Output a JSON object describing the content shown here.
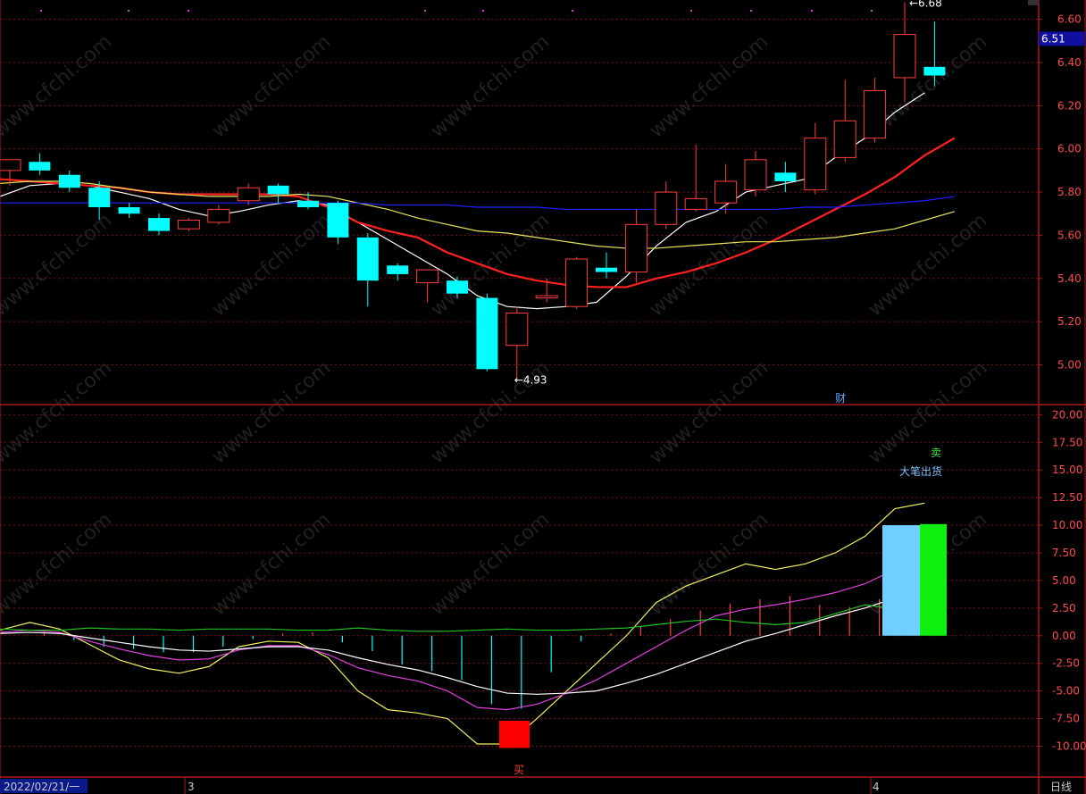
{
  "chart_data": [
    {
      "type": "candlestick",
      "panel": "price",
      "ylim": [
        4.82,
        6.64
      ],
      "yticks": [
        "6.60",
        "6.40",
        "6.20",
        "6.00",
        "5.80",
        "5.60",
        "5.40",
        "5.20",
        "5.00"
      ],
      "last_price_label": "6.51",
      "high_label": "6.68",
      "low_label": "4.93",
      "candles": [
        {
          "o": 5.9,
          "h": 5.95,
          "l": 5.83,
          "c": 5.95
        },
        {
          "o": 5.94,
          "h": 5.98,
          "l": 5.88,
          "c": 5.9
        },
        {
          "o": 5.88,
          "h": 5.9,
          "l": 5.8,
          "c": 5.82
        },
        {
          "o": 5.82,
          "h": 5.85,
          "l": 5.67,
          "c": 5.73
        },
        {
          "o": 5.73,
          "h": 5.75,
          "l": 5.68,
          "c": 5.7
        },
        {
          "o": 5.68,
          "h": 5.7,
          "l": 5.6,
          "c": 5.62
        },
        {
          "o": 5.63,
          "h": 5.68,
          "l": 5.62,
          "c": 5.67
        },
        {
          "o": 5.66,
          "h": 5.74,
          "l": 5.65,
          "c": 5.72
        },
        {
          "o": 5.76,
          "h": 5.84,
          "l": 5.74,
          "c": 5.82
        },
        {
          "o": 5.83,
          "h": 5.84,
          "l": 5.75,
          "c": 5.79
        },
        {
          "o": 5.76,
          "h": 5.8,
          "l": 5.72,
          "c": 5.73
        },
        {
          "o": 5.75,
          "h": 5.76,
          "l": 5.56,
          "c": 5.59
        },
        {
          "o": 5.59,
          "h": 5.61,
          "l": 5.27,
          "c": 5.39
        },
        {
          "o": 5.46,
          "h": 5.47,
          "l": 5.39,
          "c": 5.42
        },
        {
          "o": 5.38,
          "h": 5.44,
          "l": 5.29,
          "c": 5.44
        },
        {
          "o": 5.39,
          "h": 5.41,
          "l": 5.31,
          "c": 5.33
        },
        {
          "o": 5.31,
          "h": 5.33,
          "l": 4.97,
          "c": 4.98
        },
        {
          "o": 5.09,
          "h": 5.27,
          "l": 4.93,
          "c": 5.24
        },
        {
          "o": 5.31,
          "h": 5.4,
          "l": 5.29,
          "c": 5.32
        },
        {
          "o": 5.27,
          "h": 5.5,
          "l": 5.26,
          "c": 5.49
        },
        {
          "o": 5.45,
          "h": 5.52,
          "l": 5.4,
          "c": 5.43
        },
        {
          "o": 5.43,
          "h": 5.72,
          "l": 5.38,
          "c": 5.65
        },
        {
          "o": 5.65,
          "h": 5.85,
          "l": 5.63,
          "c": 5.8
        },
        {
          "o": 5.72,
          "h": 6.02,
          "l": 5.71,
          "c": 5.77
        },
        {
          "o": 5.75,
          "h": 5.93,
          "l": 5.7,
          "c": 5.85
        },
        {
          "o": 5.81,
          "h": 5.99,
          "l": 5.78,
          "c": 5.95
        },
        {
          "o": 5.89,
          "h": 5.94,
          "l": 5.8,
          "c": 5.85
        },
        {
          "o": 5.81,
          "h": 6.12,
          "l": 5.79,
          "c": 6.05
        },
        {
          "o": 5.96,
          "h": 6.32,
          "l": 5.94,
          "c": 6.13
        },
        {
          "o": 6.05,
          "h": 6.33,
          "l": 6.03,
          "c": 6.27
        },
        {
          "o": 6.33,
          "h": 6.68,
          "l": 6.22,
          "c": 6.53
        },
        {
          "o": 6.38,
          "h": 6.59,
          "l": 6.29,
          "c": 6.34
        }
      ],
      "ma_lines": [
        {
          "color": "#ffffff",
          "values": [
            5.78,
            5.83,
            5.84,
            5.83,
            5.8,
            5.77,
            5.72,
            5.69,
            5.71,
            5.74,
            5.76,
            5.74,
            5.66,
            5.58,
            5.5,
            5.42,
            5.32,
            5.27,
            5.26,
            5.27,
            5.29,
            5.41,
            5.55,
            5.66,
            5.71,
            5.8,
            5.83,
            5.86,
            5.96,
            6.05,
            6.17,
            6.26
          ]
        },
        {
          "color": "#ff2020",
          "values": [
            5.86,
            5.85,
            5.84,
            5.83,
            5.82,
            5.8,
            5.79,
            5.79,
            5.79,
            5.79,
            5.78,
            5.73,
            5.66,
            5.62,
            5.59,
            5.52,
            5.47,
            5.42,
            5.39,
            5.37,
            5.36,
            5.36,
            5.4,
            5.43,
            5.47,
            5.52,
            5.58,
            5.65,
            5.72,
            5.79,
            5.87,
            5.97,
            6.05
          ]
        },
        {
          "color": "#e6e65a",
          "values": [
            5.84,
            5.85,
            5.85,
            5.84,
            5.82,
            5.8,
            5.79,
            5.78,
            5.78,
            5.78,
            5.79,
            5.78,
            5.75,
            5.72,
            5.68,
            5.65,
            5.62,
            5.61,
            5.59,
            5.57,
            5.55,
            5.54,
            5.54,
            5.55,
            5.56,
            5.57,
            5.57,
            5.58,
            5.59,
            5.61,
            5.63,
            5.67,
            5.71
          ]
        },
        {
          "color": "#2020ff",
          "values": [
            5.75,
            5.75,
            5.75,
            5.75,
            5.75,
            5.75,
            5.75,
            5.75,
            5.75,
            5.75,
            5.75,
            5.75,
            5.75,
            5.74,
            5.74,
            5.74,
            5.73,
            5.73,
            5.73,
            5.72,
            5.72,
            5.72,
            5.72,
            5.72,
            5.72,
            5.72,
            5.72,
            5.73,
            5.73,
            5.74,
            5.75,
            5.76,
            5.78
          ]
        }
      ],
      "markers": [
        "财"
      ]
    },
    {
      "type": "line",
      "panel": "indicator",
      "ylim": [
        -11.5,
        21.0
      ],
      "yticks": [
        "20.00",
        "17.50",
        "15.00",
        "12.50",
        "10.00",
        "7.50",
        "5.00",
        "2.50",
        "0.00",
        "-2.50",
        "-5.00",
        "-7.50",
        "-10.00"
      ],
      "series": [
        {
          "color": "#f0f060",
          "values": [
            0.5,
            1.2,
            0.6,
            -0.8,
            -2.2,
            -3.0,
            -3.4,
            -2.8,
            -1.0,
            -0.5,
            -0.6,
            -2.0,
            -5.0,
            -6.7,
            -7.0,
            -7.5,
            -9.8,
            -9.8,
            -7.5,
            -5.0,
            -2.5,
            0.0,
            3.0,
            4.5,
            5.5,
            6.5,
            6.0,
            6.5,
            7.5,
            9.0,
            11.5,
            12.0
          ]
        },
        {
          "color": "#e040e0",
          "values": [
            0.3,
            0.5,
            0.3,
            -0.5,
            -1.2,
            -1.8,
            -2.2,
            -2.1,
            -1.3,
            -0.9,
            -0.9,
            -1.7,
            -2.9,
            -3.6,
            -4.1,
            -5.0,
            -6.5,
            -6.7,
            -6.2,
            -5.2,
            -4.0,
            -2.5,
            -1.0,
            0.5,
            1.8,
            2.4,
            2.8,
            3.3,
            3.9,
            4.7,
            6.0,
            7.0
          ]
        },
        {
          "color": "#ffffff",
          "values": [
            0.2,
            0.3,
            0.2,
            -0.2,
            -0.6,
            -1.0,
            -1.3,
            -1.4,
            -1.2,
            -1.0,
            -1.0,
            -1.3,
            -2.0,
            -2.6,
            -3.1,
            -3.8,
            -4.6,
            -5.2,
            -5.3,
            -5.2,
            -5.0,
            -4.3,
            -3.5,
            -2.5,
            -1.5,
            -0.5,
            0.2,
            1.0,
            1.8,
            2.5,
            3.4,
            4.2
          ]
        },
        {
          "color": "#20c020",
          "values": [
            0.6,
            0.5,
            0.5,
            0.7,
            0.6,
            0.6,
            0.5,
            0.6,
            0.6,
            0.6,
            0.5,
            0.5,
            0.7,
            0.5,
            0.4,
            0.4,
            0.5,
            0.6,
            0.5,
            0.5,
            0.6,
            0.7,
            1.0,
            1.3,
            1.5,
            1.2,
            1.0,
            1.2,
            2.0,
            2.8,
            2.4,
            3.0
          ]
        }
      ],
      "histogram": [
        0,
        0.5,
        -0.4,
        -1.0,
        -1.2,
        -1.5,
        -1.5,
        -1.0,
        -0.3,
        0.2,
        0.3,
        -0.6,
        -1.4,
        -2.6,
        -3.2,
        -4.0,
        -6.2,
        -6.6,
        -3.3,
        -0.5,
        0.2,
        0.8,
        1.5,
        2.3,
        2.9,
        3.3,
        3.6,
        2.8,
        2.6,
        3.3,
        3.4,
        0
      ],
      "signals": {
        "buy_label": "买",
        "buy_value": -10.0,
        "sell_label": "卖",
        "sell_text": "大笔出货",
        "sell_value": 10.0
      }
    }
  ],
  "x_axis": {
    "start_date": "2022/02/21/一",
    "month_marks": [
      "3",
      "4"
    ]
  },
  "period_label": "日线",
  "watermark": "www.cfchi.com",
  "colors": {
    "up": "#ff3d3d",
    "down": "#00ffff",
    "grid": "#7a1010",
    "frame": "#aa1a1a",
    "axis_text": "#ff4b4b",
    "price_tag_bg": "#1010a0",
    "buy_box": "#ff0000",
    "sell_box_a": "#6fcfff",
    "sell_box_b": "#10f010"
  }
}
